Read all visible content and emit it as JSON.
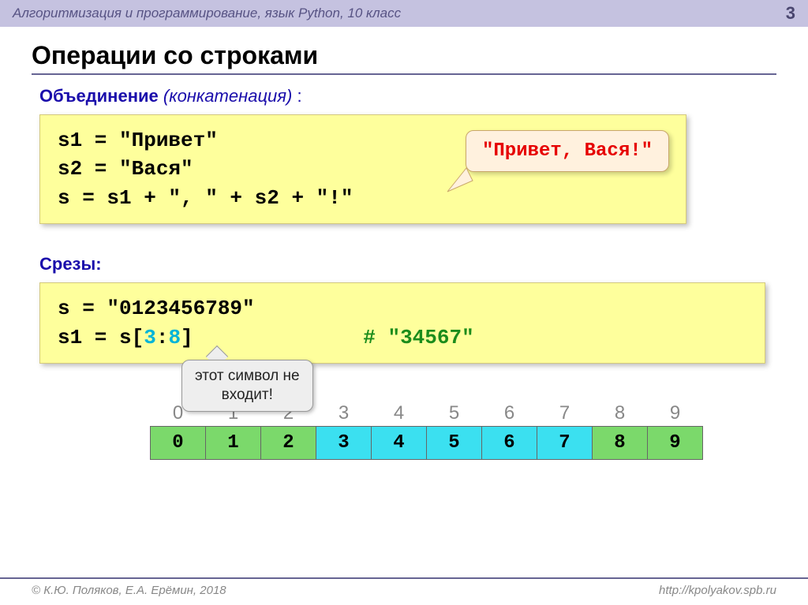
{
  "header": {
    "breadcrumb": "Алгоритмизация и программирование, язык Python, 10 класс",
    "page": "3"
  },
  "title": "Операции со строками",
  "section1": {
    "label_bold": "Объединение",
    "label_ital": " (конкатенация) ",
    "colon": ":",
    "code": {
      "l1": "s1 = \"Привет\"",
      "l2": "s2 = \"Вася\"",
      "l3": "s  = s1 + \", \" + s2 + \"!\""
    },
    "callout": "\"Привет, Вася!\""
  },
  "section2": {
    "label": "Срезы:",
    "code": {
      "l1": "s = \"0123456789\"",
      "l2a": "s1 = s[",
      "l2b": "3",
      "l2c": ":",
      "l2d": "8",
      "l2e": "]",
      "comment": "# \"34567\""
    },
    "note_l1": "этот символ не",
    "note_l2": "входит!"
  },
  "table": {
    "indices": [
      "0",
      "1",
      "2",
      "3",
      "4",
      "5",
      "6",
      "7",
      "8",
      "9"
    ],
    "values": [
      "0",
      "1",
      "2",
      "3",
      "4",
      "5",
      "6",
      "7",
      "8",
      "9"
    ],
    "highlight_start": 3,
    "highlight_end": 7
  },
  "footer": {
    "left": "© К.Ю. Поляков, Е.А. Ерёмин, 2018",
    "right": "http://kpolyakov.spb.ru"
  }
}
